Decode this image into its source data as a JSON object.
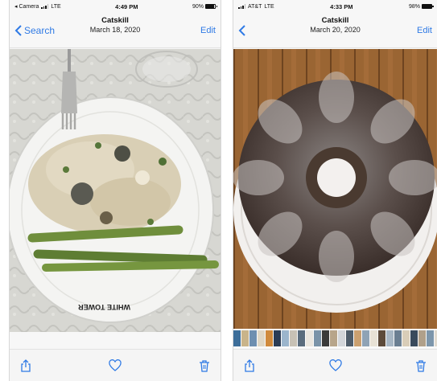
{
  "left": {
    "status": {
      "carrier": "◂ Camera",
      "network": "LTE",
      "time": "4:49 PM",
      "battery": "90%",
      "battery_level": 0.9
    },
    "nav": {
      "back_label": "Search",
      "title": "Catskill",
      "subtitle": "March 18, 2020",
      "edit_label": "Edit"
    },
    "plate_text": "WHITE TOWER"
  },
  "right": {
    "status": {
      "carrier": "AT&T",
      "network": "LTE",
      "time": "4:33 PM",
      "battery": "98%",
      "battery_level": 0.98
    },
    "nav": {
      "title": "Catskill",
      "subtitle": "March 20, 2020",
      "edit_label": "Edit"
    },
    "thumb_colors": [
      "#3d6e9a",
      "#c9b48a",
      "#6e8fb0",
      "#e0d7c5",
      "#d08a3c",
      "#2b3c55",
      "#9bb5cc",
      "#c7c1b5",
      "#5a6c7d",
      "#eae6df",
      "#7a93a8",
      "#3a3a3a",
      "#b7a58a",
      "#d3d6da",
      "#4e5c6a",
      "#caa070",
      "#8fa3b5",
      "#e8e2d5",
      "#5d4b3a",
      "#a8b7c4",
      "#6b7f92",
      "#d9cdb8",
      "#394a5c",
      "#b0a08a",
      "#7d96ab",
      "#e1dbd0",
      "#4a5560"
    ]
  },
  "colors": {
    "ios_blue": "#2f7ae5"
  }
}
